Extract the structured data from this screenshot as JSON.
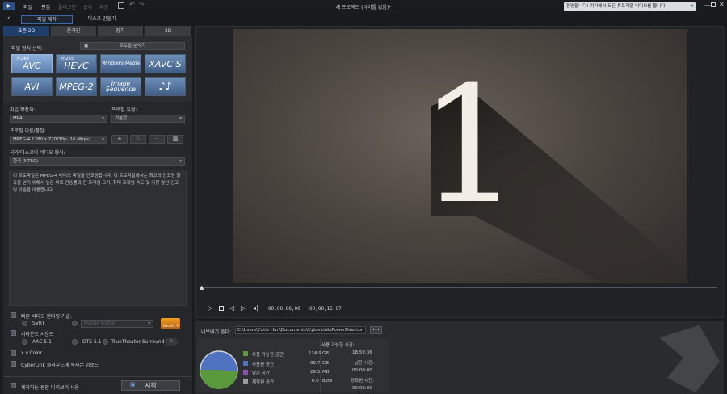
{
  "app": {
    "menu": [
      "파일",
      "편집",
      "플러그인",
      "보기",
      "재생"
    ],
    "window_title": "새 프로젝트 (타이틀 없음)*",
    "welcome": "환영합니다! 여기에서 모든 튜토리얼 비디오를 봅니다!"
  },
  "mode": {
    "produce": "파일 제작",
    "disc": "디스크 만들기"
  },
  "tabs": [
    "표준 2D",
    "온라인",
    "장치",
    "3D"
  ],
  "format_label": "파일 형식 선택:",
  "profile_analyzer": "프로필 분석기",
  "formats": [
    {
      "top": "H.264",
      "main": "AVC"
    },
    {
      "top": "H.265",
      "main": "HEVC"
    },
    {
      "top": "",
      "main": "Windows Media"
    },
    {
      "top": "",
      "main": "XAVC S"
    },
    {
      "top": "",
      "main": "AVI"
    },
    {
      "top": "",
      "main": "MPEG-2"
    },
    {
      "top": "",
      "main": "Image Sequence"
    },
    {
      "top": "",
      "main": "♪♪"
    }
  ],
  "settings": {
    "ext_label": "파일 확장자:",
    "ext_value": "MP4",
    "type_label": "프로필 유형:",
    "type_value": "기본값",
    "quality_label": "프로필 이름/품질:",
    "quality_value": "MPEG-4 1280 x 720/30p (16 Mbps)",
    "region_label": "국가/디스크의 비디오 형식:",
    "region_value": "한국 (NTSC)",
    "description": "이 프로파일은 MPEG-4 비디오 파일을 인코딩합니다. 이 프로파일에서는 최고의 인코딩 결과를 얻기 위해서 높은 비트 전송률과 큰 프레임 크기, 최대 프레임 속도 및 가장 앞선 인코딩 기술을 이용합니다."
  },
  "options": {
    "fast_render": "빠른 비디오 렌더링 기술:",
    "svrt": "SVRT",
    "hw": "NVIDIA NVENC",
    "velocity": "Velocity 3",
    "surround": "서라운드 사운드",
    "aac": "AAC 5.1",
    "dts": "DTS 5.1",
    "truetheater": "TrueTheater Surround",
    "xvcolor": "x.v.Color",
    "cyberlink": "CyberLink 클라우드에 복사본 업로드",
    "preview": "제작하는 동안 미리보기 사용",
    "start": "시작"
  },
  "player": {
    "numeral": "1",
    "time_current": "00;00;00;00",
    "time_total": "00;00;15;07"
  },
  "export": {
    "folder_label": "내보내기 폴더:",
    "path": "C:\\Users\\Cutie Han\\Documents\\CyberLink\\PowerDirector",
    "browse": "•••",
    "disk": [
      {
        "label": "사용 가능한 공간",
        "value": "124.9",
        "unit": "GB",
        "color": "#5a9a3c"
      },
      {
        "label": "사용된 공간",
        "value": "99.7",
        "unit": "GB",
        "color": "#4f73c0"
      },
      {
        "label": "남은 공간",
        "value": "29.5",
        "unit": "MB",
        "color": "#8b4fb5"
      },
      {
        "label": "제작된 공간",
        "value": "0.0",
        "unit": "Byte",
        "color": "#9a9da2"
      }
    ],
    "time": [
      {
        "label": "사용 가능한 시간:",
        "value": "18:59:36"
      },
      {
        "label": "남은 시간:",
        "value": "00:00:00"
      },
      {
        "label": "경과된 시간:",
        "value": "00:00:00"
      }
    ]
  }
}
